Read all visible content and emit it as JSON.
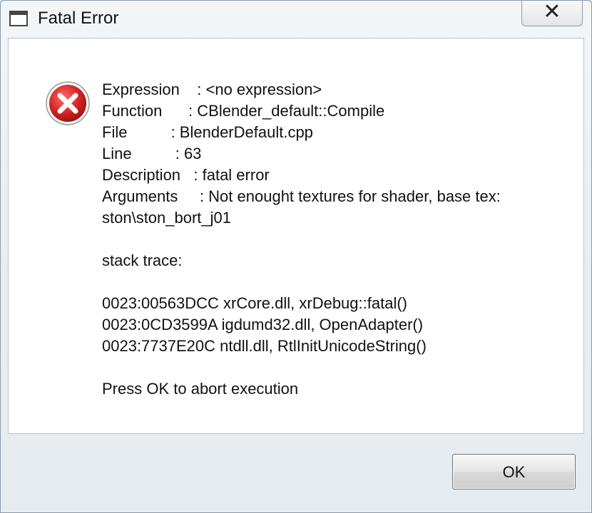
{
  "window": {
    "title": "Fatal Error",
    "close_glyph": "✕",
    "title_icon": "window-app-icon",
    "error_icon": "error-x-icon"
  },
  "message": {
    "lines": [
      "Expression    : <no expression>",
      "Function      : CBlender_default::Compile",
      "File          : BlenderDefault.cpp",
      "Line          : 63",
      "Description   : fatal error",
      "Arguments     : Not enought textures for shader, base tex:",
      "ston\\ston_bort_j01",
      "",
      "stack trace:",
      "",
      "0023:00563DCC xrCore.dll, xrDebug::fatal()",
      "0023:0CD3599A igdumd32.dll, OpenAdapter()",
      "0023:7737E20C ntdll.dll, RtlInitUnicodeString()",
      "",
      "Press OK to abort execution"
    ]
  },
  "buttons": {
    "ok_label": "OK"
  },
  "colors": {
    "error_red": "#d42424",
    "accent_border": "#8a9aa8"
  }
}
